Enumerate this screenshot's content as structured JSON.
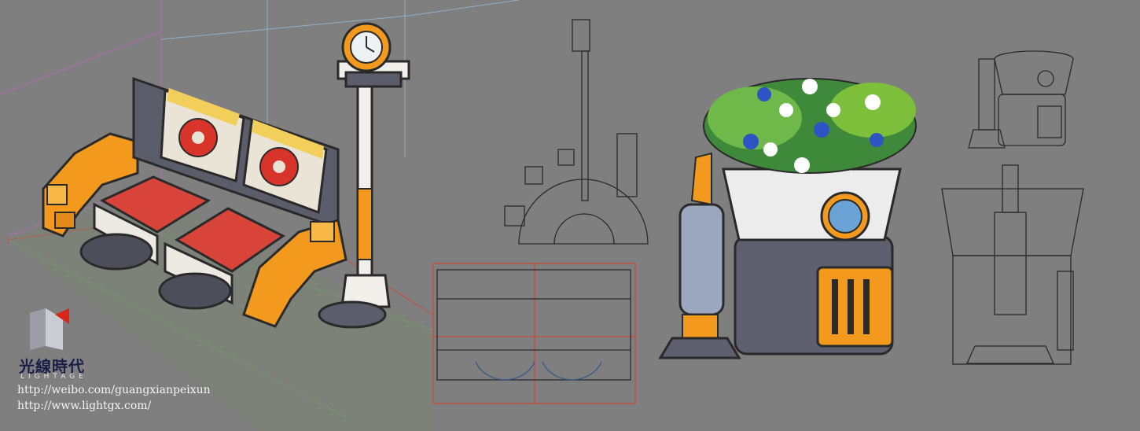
{
  "watermark": {
    "brand_cn": "光線時代",
    "brand_en": "LIGHTAGE",
    "urls": [
      "http://weibo.com/guangxianpeixun",
      "http://www.lightgx.com/"
    ]
  },
  "colors": {
    "background": "#7f7f7f",
    "accent_orange": "#f39a1e",
    "accent_red": "#c9342a",
    "metal_gray": "#5f6272",
    "line_art": "#2a2a2a"
  }
}
